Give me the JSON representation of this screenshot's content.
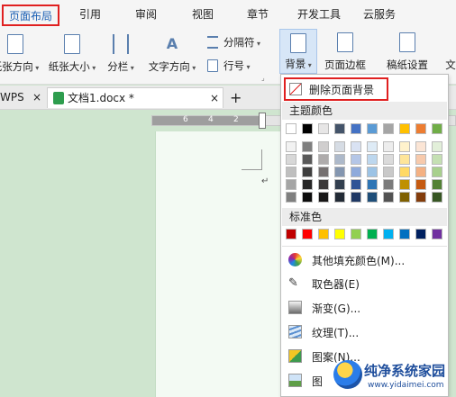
{
  "menu_tabs": [
    "页面布局",
    "引用",
    "审阅",
    "视图",
    "章节",
    "开发工具",
    "云服务"
  ],
  "ribbon": {
    "orientation": "纸张方向",
    "paper_size": "纸张大小",
    "columns": "分栏",
    "text_direction": "文字方向",
    "separator": "分隔符",
    "line_number": "行号",
    "background": "背景",
    "page_border": "页面边框",
    "paper_settings": "稿纸设置",
    "more": "文"
  },
  "tabs": {
    "wps": "WPS",
    "doc": "文档1.docx *",
    "close": "×",
    "add": "+"
  },
  "ruler_numbers": [
    "6",
    "4",
    "2"
  ],
  "return_mark": "↵",
  "dropdown": {
    "remove_bg": "删除页面背景",
    "theme_colors": "主题颜色",
    "standard_colors": "标准色",
    "more_fill": "其他填充颜色(M)...",
    "eyedropper": "取色器(E)",
    "gradient": "渐变(G)...",
    "texture": "纹理(T)...",
    "pattern": "图案(N)...",
    "picture": "图"
  },
  "theme_palette": {
    "top_row": [
      "#ffffff",
      "#000000",
      "#e7e6e6",
      "#44546a",
      "#4472c4",
      "#5b9bd5",
      "#a5a5a5",
      "#ffc000",
      "#ed7d31",
      "#70ad47"
    ],
    "shades": [
      [
        "#f2f2f2",
        "#7f7f7f",
        "#d0cece",
        "#d6dce4",
        "#d9e2f3",
        "#deebf6",
        "#ededed",
        "#fff2cc",
        "#fbe5d5",
        "#e2efd9"
      ],
      [
        "#d8d8d8",
        "#595959",
        "#aeabab",
        "#adb9ca",
        "#b4c6e7",
        "#bdd7ee",
        "#dbdbdb",
        "#fee599",
        "#f7caac",
        "#c5e0b3"
      ],
      [
        "#bfbfbf",
        "#3f3f3f",
        "#757070",
        "#8496b0",
        "#8eaadb",
        "#9cc3e5",
        "#c9c9c9",
        "#ffd965",
        "#f4b183",
        "#a8d08d"
      ],
      [
        "#a5a5a5",
        "#262626",
        "#3a3838",
        "#323f4f",
        "#2f5496",
        "#2e75b5",
        "#7b7b7b",
        "#bf9000",
        "#c55a11",
        "#538135"
      ],
      [
        "#7f7f7f",
        "#0c0c0c",
        "#171616",
        "#222a35",
        "#1f3864",
        "#1e4e79",
        "#525252",
        "#7f6000",
        "#833c0b",
        "#375623"
      ]
    ]
  },
  "standard_palette": [
    "#c00000",
    "#ff0000",
    "#ffc000",
    "#ffff00",
    "#92d050",
    "#00b050",
    "#00b0f0",
    "#0070c0",
    "#002060",
    "#7030a0"
  ],
  "watermark": {
    "name": "纯净系统家园",
    "url": "www.yidaimei.com"
  },
  "colors": {
    "highlight_red": "#e02020",
    "accent_blue": "#1a5fb4",
    "canvas_green": "#cfe5cf"
  }
}
